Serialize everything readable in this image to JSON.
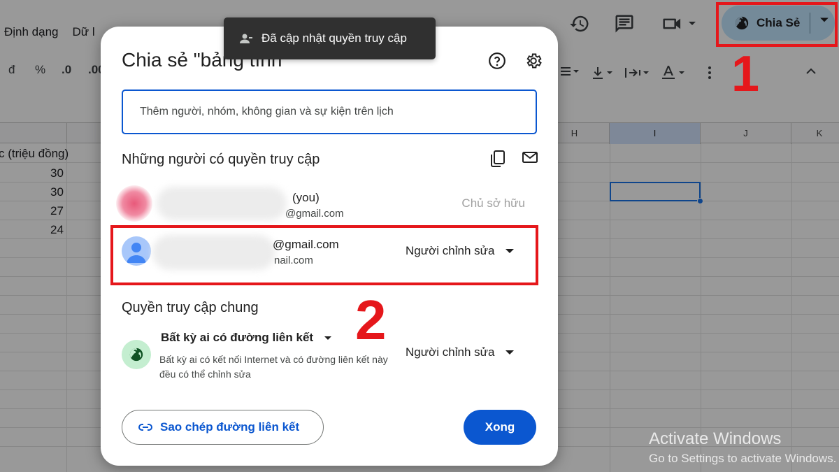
{
  "menubar": {
    "items": [
      "Định dạng",
      "Dữ l"
    ]
  },
  "header": {
    "share_label": "Chia Sẻ"
  },
  "toolbar": {
    "currency_symbol": "đ",
    "percent_symbol": "%",
    "decrease_decimal": ".0",
    "increase_decimal": ".00"
  },
  "grid": {
    "columns": [
      "H",
      "I",
      "J",
      "K"
    ],
    "selected_column": "I",
    "header_cell": "c (triệu đồng)",
    "values": [
      "30",
      "30",
      "27",
      "24"
    ]
  },
  "toast": {
    "text": "Đã cập nhật quyền truy cập"
  },
  "dialog": {
    "title": "Chia sẻ \"bảng tính",
    "search_placeholder": "Thêm người, nhóm, không gian và sự kiện trên lịch",
    "people_heading": "Những người có quyền truy cập",
    "people": [
      {
        "name": "(you)",
        "email": "@gmail.com",
        "role": "Chủ sở hữu"
      },
      {
        "name": "@gmail.com",
        "email": "nail.com",
        "role": "Người chỉnh sửa"
      }
    ],
    "general_heading": "Quyền truy cập chung",
    "general_access": {
      "option": "Bất kỳ ai có đường liên kết",
      "description": "Bất kỳ ai có kết nối Internet và có đường liên kết này đều có thể chỉnh sửa",
      "role": "Người chỉnh sửa"
    },
    "copy_link_label": "Sao chép đường liên kết",
    "done_label": "Xong"
  },
  "annotations": {
    "step1": "1",
    "step2": "2"
  },
  "watermark": {
    "line1": "Activate Windows",
    "line2": "Go to Settings to activate Windows."
  },
  "colors": {
    "accent": "#0b57d0",
    "share_bg": "#c2e7ff",
    "annotation": "#e5171b",
    "toast_bg": "#303030"
  }
}
